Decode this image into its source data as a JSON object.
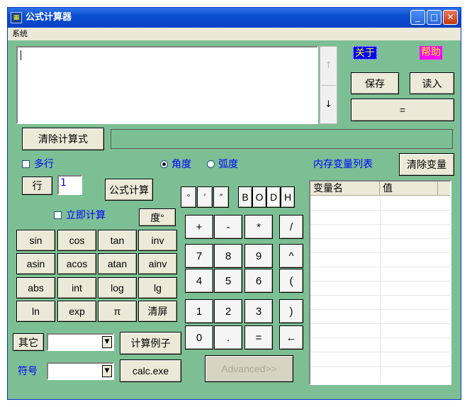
{
  "window": {
    "title": "公式计算器",
    "minimize": "_",
    "maximize": "□",
    "close": "✕"
  },
  "menu": {
    "system": "系统"
  },
  "about_label": "关于",
  "help_label": "帮助",
  "save_label": "保存",
  "load_label": "读入",
  "equals_label": "=",
  "scroll": {
    "up": "↑",
    "down": "↓"
  },
  "clear_formula_label": "清除计算式",
  "multiline_label": "多行",
  "degree_label": "角度",
  "radian_label": "弧度",
  "variable_list_label": "内存变量列表",
  "clear_variables_label": "清除变量",
  "row_button_label": "行",
  "row_value": "1",
  "formula_calc_label": "公式计算",
  "instant_calc_label": "立即计算",
  "degree_sym_label": "度°",
  "angle_buttons": [
    "°",
    "′",
    "″"
  ],
  "base_buttons": [
    "B",
    "O",
    "D",
    "H"
  ],
  "functions": [
    [
      "sin",
      "cos",
      "tan",
      "inv"
    ],
    [
      "asin",
      "acos",
      "atan",
      "ainv"
    ],
    [
      "abs",
      "int",
      "log",
      "lg"
    ],
    [
      "ln",
      "exp",
      "π",
      "清屏"
    ]
  ],
  "keypad": [
    [
      "+",
      "-",
      "*",
      "/"
    ],
    [
      "7",
      "8",
      "9",
      "^"
    ],
    [
      "4",
      "5",
      "6",
      "("
    ],
    [
      "1",
      "2",
      "3",
      ")"
    ],
    [
      "0",
      ".",
      "=",
      "←"
    ]
  ],
  "other_label": "其它",
  "examples_label": "计算例子",
  "symbol_label": "符号",
  "calc_exe_label": "calc.exe",
  "advanced_label": "Advanced>>",
  "table_headers": [
    "变量名",
    "值"
  ],
  "colors": {
    "accent": "#0000ff",
    "background": "#7dbf94",
    "titlebar": "#0a4fd1"
  }
}
